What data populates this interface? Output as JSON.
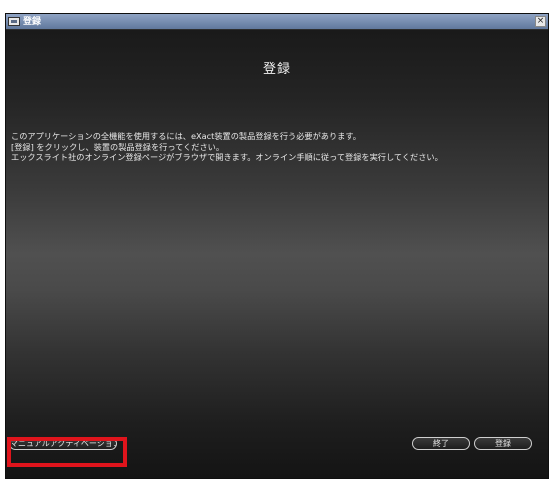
{
  "window": {
    "title": "登録",
    "close_glyph": "×",
    "icon": "app-icon"
  },
  "main": {
    "heading": "登録",
    "message_lines": [
      "このアプリケーションの全機能を使用するには、eXact装置の製品登録を行う必要があります。",
      "[登録] をクリックし、装置の製品登録を行ってください。",
      "エックスライト社のオンライン登録ページがブラウザで開きます。オンライン手順に従って登録を実行してください。"
    ]
  },
  "buttons": {
    "manual_activation": "マニュアルアクティベーション",
    "exit": "終了",
    "register": "登録"
  },
  "annotation": {
    "highlight_color": "#e0141c"
  }
}
